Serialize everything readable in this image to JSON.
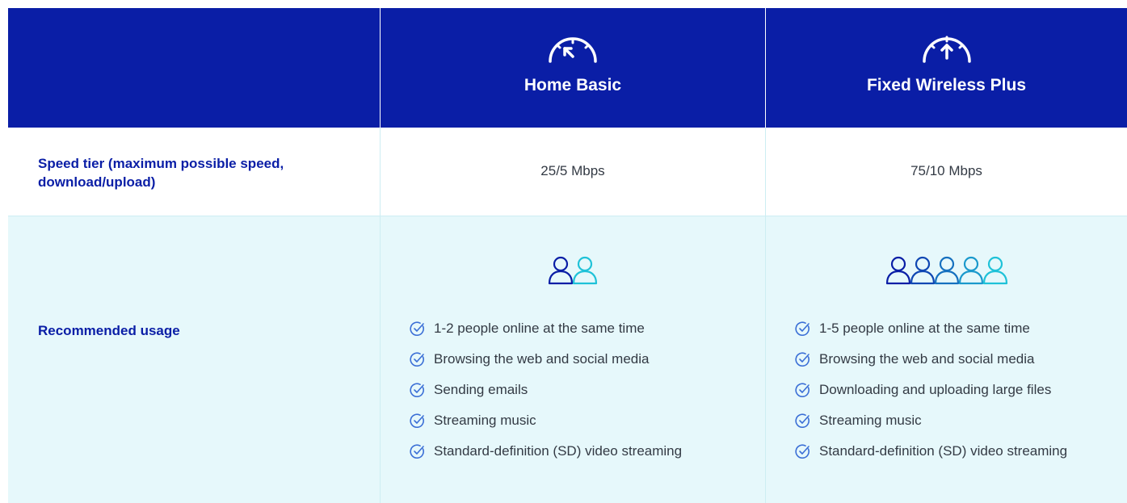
{
  "plans": [
    {
      "name": "Home Basic",
      "icon": "gauge-low-icon",
      "speed": "25/5 Mbps",
      "user_count": 2,
      "features": [
        "1-2 people online at the same time",
        "Browsing the web and social media",
        "Sending emails",
        "Streaming music",
        "Standard-definition (SD) video streaming"
      ]
    },
    {
      "name": "Fixed Wireless Plus",
      "icon": "gauge-high-icon",
      "speed": "75/10 Mbps",
      "user_count": 5,
      "features": [
        "1-5 people online at the same time",
        "Browsing the web and social media",
        "Downloading and uploading large files",
        "Streaming music",
        "Standard-definition (SD) video streaming"
      ]
    }
  ],
  "rows": {
    "speed_label": "Speed tier (maximum possible speed, download/upload)",
    "usage_label": "Recommended usage"
  },
  "colors": {
    "header_bg": "#0a1ea6",
    "usage_bg": "#e6f8fb",
    "user_dark": "#0a1ea6",
    "user_light": "#1fc2d8",
    "check": "#3b6fd6"
  }
}
